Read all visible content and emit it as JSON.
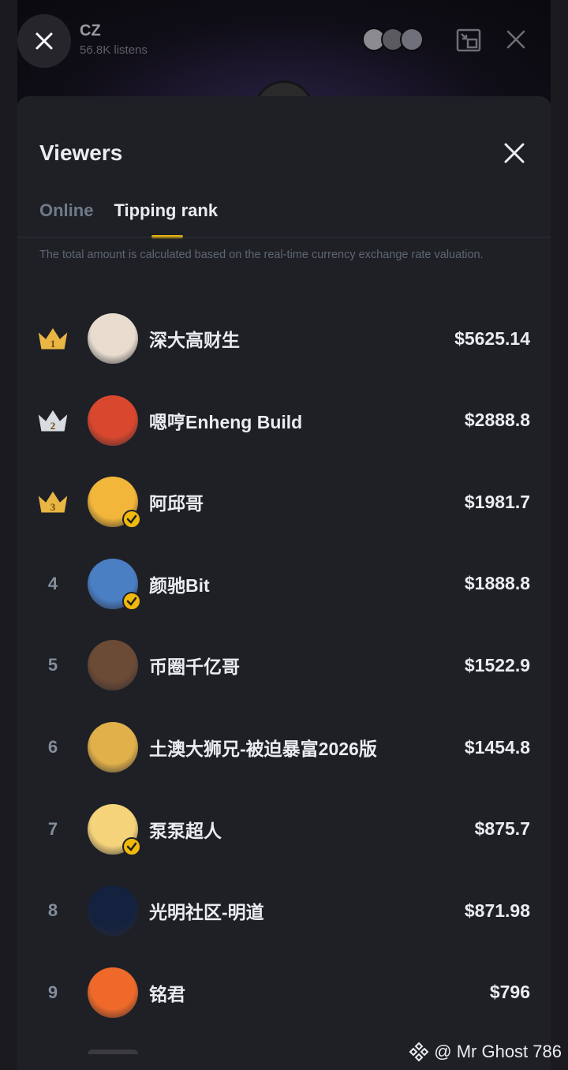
{
  "room": {
    "host_name": "CZ",
    "host_listens": "56.8K listens",
    "close_icon": "close-icon",
    "minimize_icon": "minimize-icon",
    "exit_icon": "close-icon"
  },
  "sheet": {
    "title": "Viewers",
    "tabs": [
      {
        "label": "Online",
        "active": false
      },
      {
        "label": "Tipping rank",
        "active": true
      }
    ],
    "note": "The total amount is calculated based on the real-time currency exchange rate valuation."
  },
  "ranking": [
    {
      "rank": "1",
      "name": "深大高财生",
      "amount": "$5625.14",
      "crown": "gold",
      "verified": false,
      "avatar_color": "#e8dccf"
    },
    {
      "rank": "2",
      "name": "嗯哼Enheng Build",
      "amount": "$2888.8",
      "crown": "silver",
      "verified": false,
      "avatar_color": "#d9482e"
    },
    {
      "rank": "3",
      "name": "阿邱哥",
      "amount": "$1981.7",
      "crown": "bronze",
      "verified": true,
      "avatar_color": "#f2b63a"
    },
    {
      "rank": "4",
      "name": "颜驰Bit",
      "amount": "$1888.8",
      "crown": "",
      "verified": true,
      "avatar_color": "#4a7fc4"
    },
    {
      "rank": "5",
      "name": "币圈千亿哥",
      "amount": "$1522.9",
      "crown": "",
      "verified": false,
      "avatar_color": "#6b4a36"
    },
    {
      "rank": "6",
      "name": "土澳大狮兄-被迫暴富2026版",
      "amount": "$1454.8",
      "crown": "",
      "verified": false,
      "avatar_color": "#e0b04a"
    },
    {
      "rank": "7",
      "name": "泵泵超人",
      "amount": "$875.7",
      "crown": "",
      "verified": true,
      "avatar_color": "#f5d37a"
    },
    {
      "rank": "8",
      "name": "光明社区-明道",
      "amount": "$871.98",
      "crown": "",
      "verified": false,
      "avatar_color": "#14213f"
    },
    {
      "rank": "9",
      "name": "铭君",
      "amount": "$796",
      "crown": "",
      "verified": false,
      "avatar_color": "#ef6a2a"
    }
  ],
  "watermark": "@ Mr Ghost 786",
  "colors": {
    "accent": "#f0b90b",
    "background": "#1e2026",
    "muted": "#707a8a"
  }
}
